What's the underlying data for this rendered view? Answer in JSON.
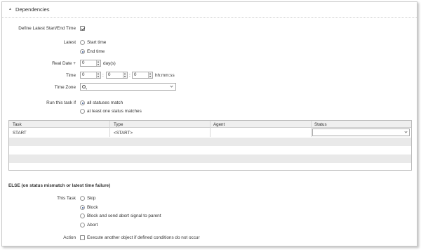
{
  "panel": {
    "title": "Dependencies"
  },
  "define_latest": {
    "label": "Define Latest Start/End Time",
    "checked": true
  },
  "latest": {
    "label": "Latest",
    "options": [
      "Start time",
      "End time"
    ],
    "selected": "End time"
  },
  "real_date": {
    "label": "Real Date +",
    "value": "0",
    "unit": "day(s)"
  },
  "time": {
    "label": "Time",
    "hours": "0",
    "minutes": "0",
    "seconds": "0",
    "sep": ":",
    "format": "hh:mm:ss"
  },
  "time_zone": {
    "label": "Time Zone",
    "value": ""
  },
  "run_if": {
    "label": "Run this task if",
    "options": [
      "all statuses match",
      "at least one status matches"
    ],
    "selected": "all statuses match"
  },
  "table": {
    "columns": [
      "Task",
      "Type",
      "Agent",
      "Status"
    ],
    "rows": [
      {
        "task": "START",
        "type": "<START>",
        "agent": "",
        "status": ""
      }
    ]
  },
  "else_section": {
    "title": "ELSE (on status mismatch or latest time failure)",
    "this_task_label": "This Task",
    "options": [
      "Skip",
      "Block",
      "Block and send abort signal to parent",
      "Abort"
    ],
    "selected": "Block",
    "action_label": "Action",
    "action_option": "Execute another object if defined conditions do not occur",
    "action_checked": false
  }
}
